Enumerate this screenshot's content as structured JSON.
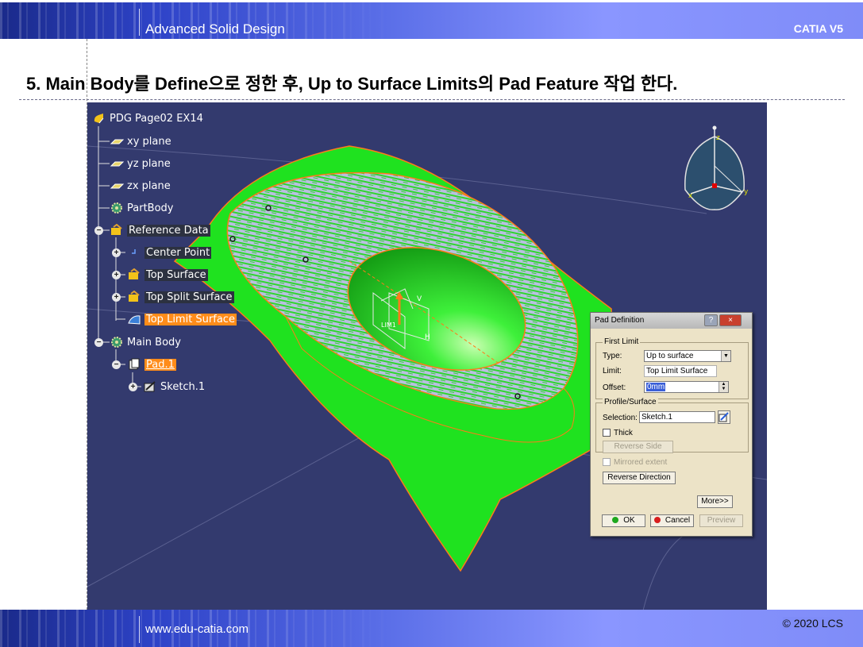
{
  "header": {
    "title": "Advanced Solid Design",
    "product": "CATIA V5"
  },
  "heading": "5. Main Body를 Define으로 정한 후, Up to Surface Limits의 Pad Feature 작업 한다.",
  "tree": {
    "root": "PDG Page02 EX14",
    "items": [
      {
        "label": "xy plane"
      },
      {
        "label": "yz plane"
      },
      {
        "label": "zx plane"
      },
      {
        "label": "PartBody"
      },
      {
        "label": "Reference Data"
      },
      {
        "label": "Center Point"
      },
      {
        "label": "Top Surface"
      },
      {
        "label": "Top Split Surface"
      },
      {
        "label": "Top Limit Surface"
      },
      {
        "label": "Main Body"
      },
      {
        "label": "Pad.1"
      },
      {
        "label": "Sketch.1"
      }
    ]
  },
  "compass": {
    "z": "z",
    "x": "x",
    "y": "y"
  },
  "manip": {
    "limit_tag": "LIM1",
    "h_tag": "H",
    "v_tag": "V"
  },
  "dialog": {
    "title": "Pad Definition",
    "help": "?",
    "close": "×",
    "first_limit": "First Limit",
    "type_label": "Type:",
    "type_value": "Up to surface",
    "limit_label": "Limit:",
    "limit_value": "Top Limit Surface",
    "offset_label": "Offset:",
    "offset_value": "0mm",
    "profile_surface": "Profile/Surface",
    "selection_label": "Selection:",
    "selection_value": "Sketch.1",
    "thick": "Thick",
    "reverse_side": "Reverse Side",
    "mirrored_extent": "Mirrored extent",
    "reverse_direction": "Reverse Direction",
    "more": "More>>",
    "ok": "OK",
    "cancel": "Cancel",
    "preview": "Preview"
  },
  "footer": {
    "url": "www.edu-catia.com",
    "copyright": "© 2020 LCS"
  },
  "colors": {
    "viewport_bg": "#333a6e",
    "surface_green": "#1fe21f",
    "highlight_orange": "#ff8c1a",
    "band_blue": "#5b6fe8"
  }
}
